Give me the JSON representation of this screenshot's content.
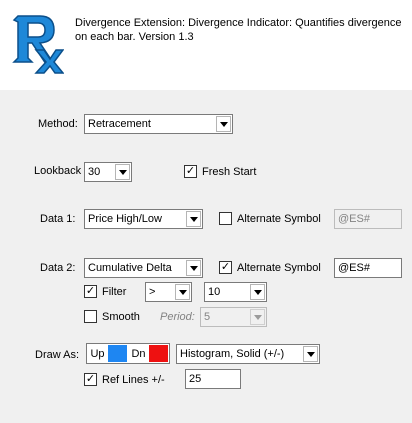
{
  "header": {
    "description": "Divergence Extension: Divergence Indicator: Quantifies divergence on each bar. Version 1.3",
    "logo_icon": "rx-logo"
  },
  "method": {
    "label": "Method:",
    "value": "Retracement"
  },
  "lookback": {
    "label": "Lookback",
    "value": "30",
    "fresh_start_label": "Fresh Start",
    "fresh_start_checked": true
  },
  "data1": {
    "label": "Data 1:",
    "value": "Price High/Low",
    "alt_symbol_label": "Alternate Symbol",
    "alt_symbol_checked": false,
    "alt_symbol_value": "@ES#"
  },
  "data2": {
    "label": "Data 2:",
    "value": "Cumulative Delta",
    "alt_symbol_label": "Alternate Symbol",
    "alt_symbol_checked": true,
    "alt_symbol_value": "@ES#",
    "filter_label": "Filter",
    "filter_checked": true,
    "filter_operator": ">",
    "filter_value": "10",
    "smooth_label": "Smooth",
    "smooth_checked": false,
    "period_label": "Period:",
    "period_value": "5"
  },
  "draw_as": {
    "label": "Draw As:",
    "up_label": "Up",
    "up_color": "#1e86f2",
    "dn_label": "Dn",
    "dn_color": "#ee1111",
    "style_value": "Histogram, Solid (+/-)",
    "ref_lines_label": "Ref Lines +/-",
    "ref_lines_checked": true,
    "ref_lines_value": "25"
  }
}
